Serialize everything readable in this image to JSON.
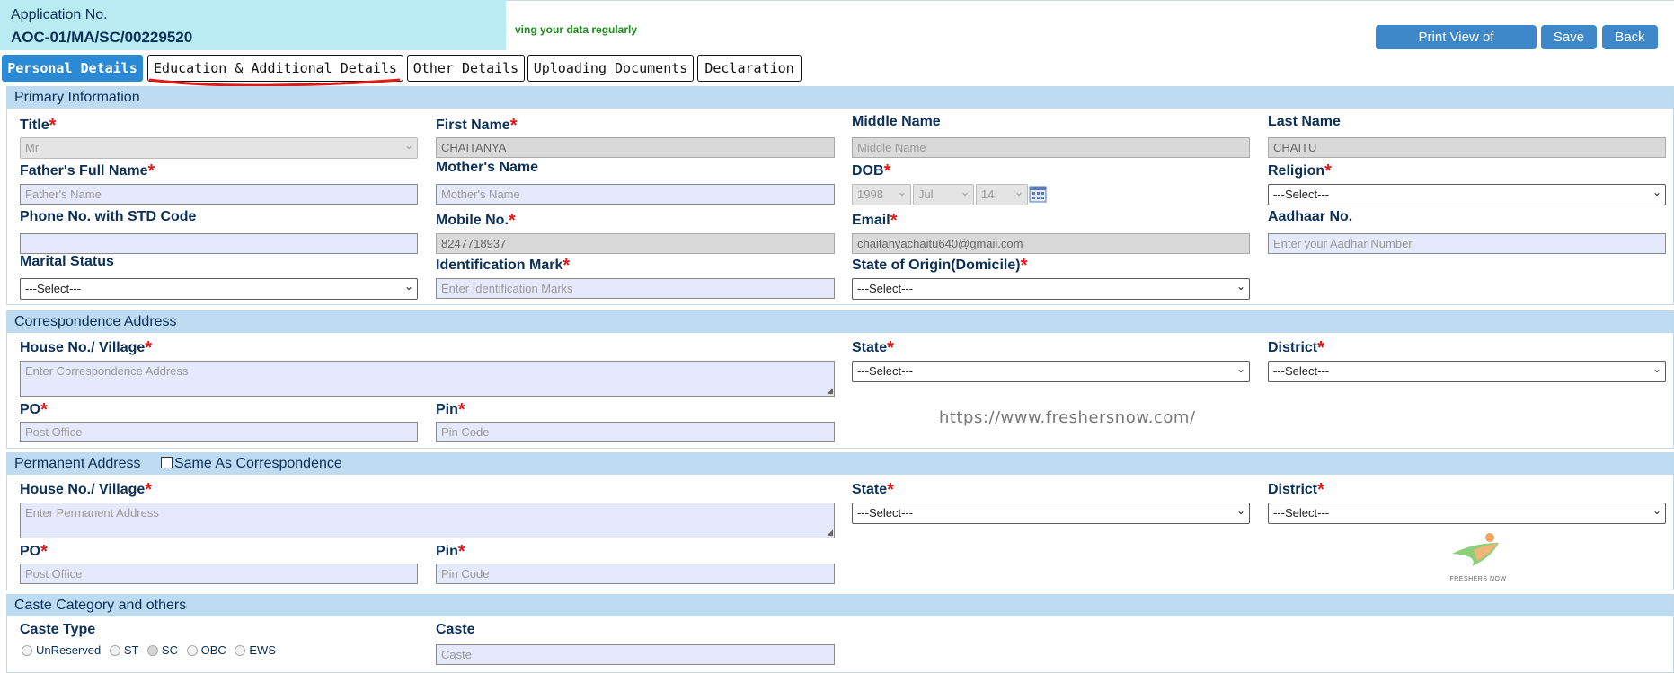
{
  "header": {
    "application_label": "Application No.",
    "application_number": "AOC-01/MA/SC/00229520",
    "notice": "ving your data regularly",
    "buttons": {
      "print": "Print View of Application",
      "save": "Save",
      "back": "Back"
    }
  },
  "tabs": [
    {
      "label": "Personal Details",
      "active": true
    },
    {
      "label": "Education & Additional Details"
    },
    {
      "label": "Other Details"
    },
    {
      "label": "Uploading Documents"
    },
    {
      "label": "Declaration"
    }
  ],
  "primary": {
    "heading": "Primary Information",
    "title_label": "Title",
    "title_value": "Mr",
    "first_name_label": "First Name",
    "first_name_value": "CHAITANYA",
    "middle_name_label": "Middle Name",
    "middle_name_placeholder": "Middle Name",
    "last_name_label": "Last Name",
    "last_name_value": "CHAITU",
    "father_label": "Father's Full Name",
    "father_placeholder": "Father's Name",
    "mother_label": "Mother's Name",
    "mother_placeholder": "Mother's Name",
    "dob_label": "DOB",
    "dob_year": "1998",
    "dob_month": "Jul",
    "dob_day": "14",
    "religion_label": "Religion",
    "religion_value": "---Select---",
    "phone_label": "Phone No. with STD Code",
    "mobile_label": "Mobile No.",
    "mobile_value": "8247718937",
    "email_label": "Email",
    "email_value": "chaitanyachaitu640@gmail.com",
    "aadhaar_label": "Aadhaar No.",
    "aadhaar_placeholder": "Enter your Aadhar Number",
    "marital_label": "Marital Status",
    "marital_value": "---Select---",
    "idmark_label": "Identification Mark",
    "idmark_placeholder": "Enter Identification Marks",
    "domicile_label": "State of Origin(Domicile)",
    "domicile_value": "---Select---"
  },
  "correspondence": {
    "heading": "Correspondence Address",
    "house_label": "House No./ Village",
    "house_placeholder": "Enter Correspondence Address",
    "state_label": "State",
    "state_value": "---Select---",
    "district_label": "District",
    "district_value": "---Select---",
    "po_label": "PO",
    "po_placeholder": "Post Office",
    "pin_label": "Pin",
    "pin_placeholder": "Pin Code"
  },
  "watermark": "https://www.freshersnow.com/",
  "permanent": {
    "heading": "Permanent Address",
    "same_as_label": "Same As Correspondence",
    "house_label": "House No./ Village",
    "house_placeholder": "Enter Permanent Address",
    "state_label": "State",
    "state_value": "---Select---",
    "district_label": "District",
    "district_value": "---Select---",
    "po_label": "PO",
    "po_placeholder": "Post Office",
    "pin_label": "Pin",
    "pin_placeholder": "Pin Code",
    "logo_text": "FRESHERS NOW"
  },
  "caste": {
    "heading": "Caste Category and others",
    "caste_type_label": "Caste Type",
    "options": [
      "UnReserved",
      "ST",
      "SC",
      "OBC",
      "EWS"
    ],
    "caste_label": "Caste",
    "caste_placeholder": "Caste"
  },
  "colors": {
    "accent": "#2b8ad6",
    "section_header": "#bddcf2",
    "required": "#e01919",
    "app_box": "#b8ecf2"
  }
}
